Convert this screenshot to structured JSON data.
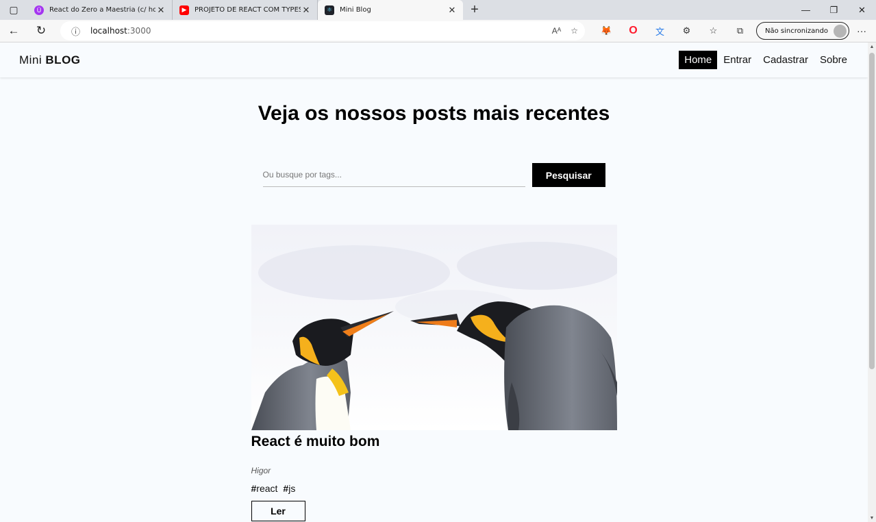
{
  "browser": {
    "tabs": [
      {
        "title": "React do Zero a Maestria (c/ hoo",
        "favicon_color": "#a435f0"
      },
      {
        "title": "PROJETO DE REACT COM TYPESC",
        "favicon_color": "#ff0000"
      },
      {
        "title": "Mini Blog",
        "favicon_color": "#20232a"
      }
    ],
    "url_host": "localhost",
    "url_port": ":3000",
    "profile_label": "Não sincronizando"
  },
  "site": {
    "brand_light": "Mini",
    "brand_bold": "BLOG",
    "nav": [
      {
        "label": "Home",
        "active": true
      },
      {
        "label": "Entrar",
        "active": false
      },
      {
        "label": "Cadastrar",
        "active": false
      },
      {
        "label": "Sobre",
        "active": false
      }
    ]
  },
  "home": {
    "heading": "Veja os nossos posts mais recentes",
    "search_placeholder": "Ou busque por tags...",
    "search_button": "Pesquisar"
  },
  "posts": [
    {
      "title": "React é muito bom",
      "author": "Higor",
      "tags": [
        "react",
        "js"
      ],
      "read_label": "Ler",
      "image": "penguins"
    }
  ]
}
